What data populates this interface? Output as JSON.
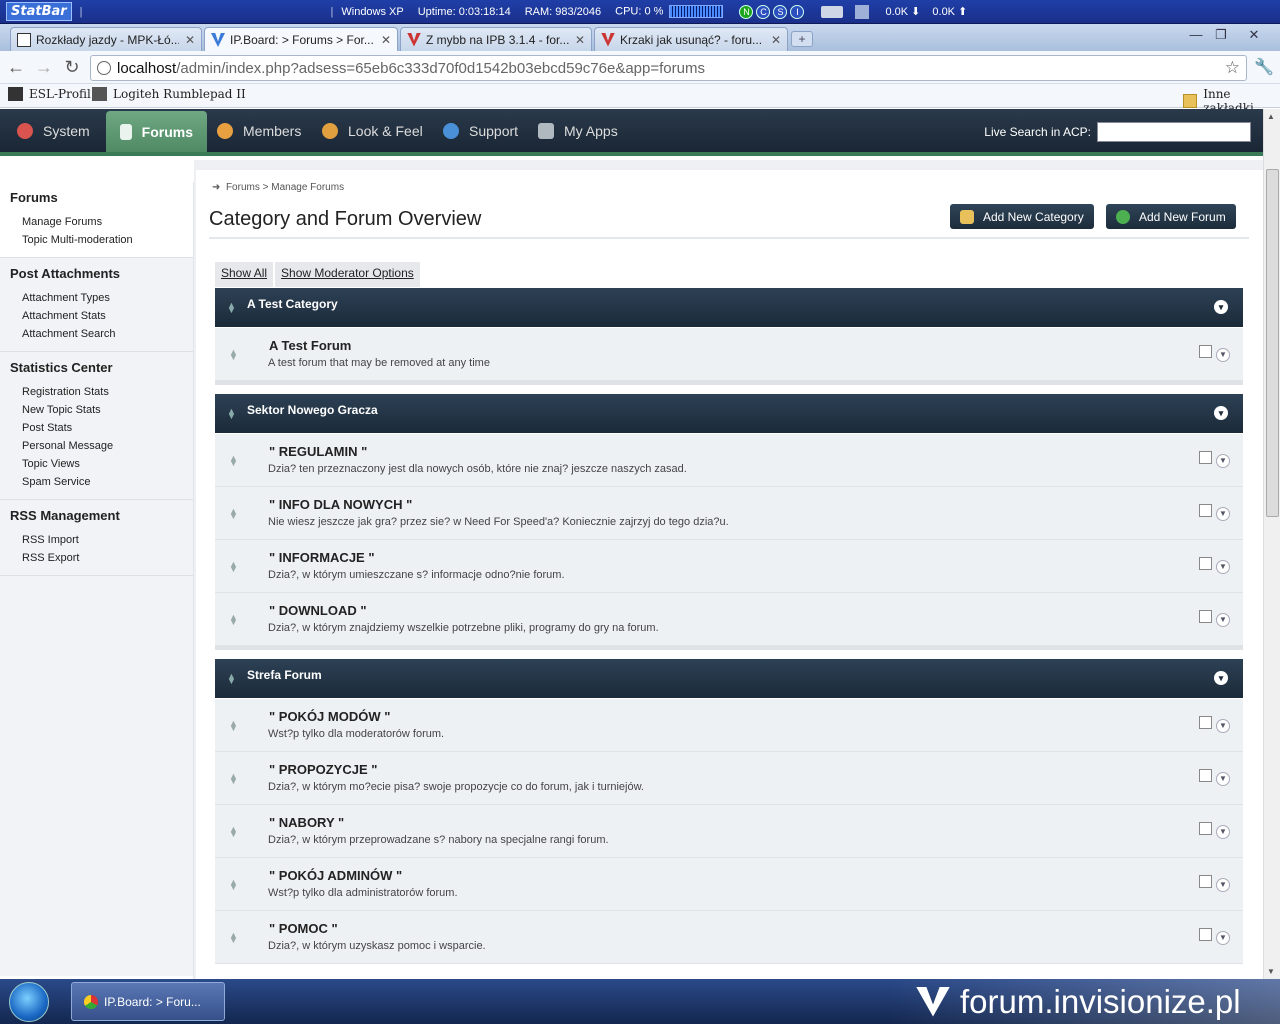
{
  "statbar": {
    "logo": "StatBar",
    "os": "Windows XP",
    "uptime_label": "Uptime:",
    "uptime_value": "0:03:18:14",
    "ram_label": "RAM:",
    "ram_value": "983/2046",
    "cpu_label": "CPU:",
    "cpu_value": "0 %",
    "indicators": [
      "N",
      "C",
      "S",
      "I"
    ],
    "net_down": "0.0K",
    "net_up": "0.0K"
  },
  "browser": {
    "tabs": [
      {
        "label": "Rozkłady jazdy - MPK-Łó..."
      },
      {
        "label": "IP.Board: > Forums > For..."
      },
      {
        "label": "Z mybb na IPB 3.1.4 - for..."
      },
      {
        "label": "Krzaki jak usunąć? - foru..."
      }
    ],
    "new_tab": "+",
    "url_host": "localhost",
    "url_path": "/admin/index.php?adsess=65eb6c333d70f0d1542b03ebcd59c76e&app=forums",
    "bookmarks": [
      "ESL-Profil",
      "Logiteh Rumblepad II"
    ],
    "other_bookmarks": "Inne zakładki"
  },
  "acp": {
    "nav": [
      {
        "label": "System",
        "color": "#d9534f"
      },
      {
        "label": "Forums",
        "color": "#ffffff"
      },
      {
        "label": "Members",
        "color": "#e8a040"
      },
      {
        "label": "Look & Feel",
        "color": "#e0a040"
      },
      {
        "label": "Support",
        "color": "#4a90d9"
      },
      {
        "label": "My Apps",
        "color": "#b0b8c0"
      }
    ],
    "live_search_label": "Live Search in ACP:"
  },
  "sidebar": {
    "sections": [
      {
        "title": "Forums",
        "items": [
          "Manage Forums",
          "Topic Multi-moderation"
        ]
      },
      {
        "title": "Post Attachments",
        "items": [
          "Attachment Types",
          "Attachment Stats",
          "Attachment Search"
        ]
      },
      {
        "title": "Statistics Center",
        "items": [
          "Registration Stats",
          "New Topic Stats",
          "Post Stats",
          "Personal Message",
          "Topic Views",
          "Spam Service"
        ]
      },
      {
        "title": "RSS Management",
        "items": [
          "RSS Import",
          "RSS Export"
        ]
      }
    ]
  },
  "main": {
    "breadcrumb": [
      "Forums",
      ">",
      "Manage Forums"
    ],
    "title": "Category and Forum Overview",
    "add_category": "Add New Category",
    "add_forum": "Add New Forum",
    "show_all": "Show All",
    "show_mod": "Show Moderator Options",
    "categories": [
      {
        "name": "A Test Category",
        "forums": [
          {
            "name": "A Test Forum",
            "desc": "A test forum that may be removed at any time"
          }
        ]
      },
      {
        "name": "Sektor Nowego Gracza",
        "forums": [
          {
            "name": "\" REGULAMIN \"",
            "desc": "Dzia? ten przeznaczony jest dla nowych osób, które nie znaj? jeszcze naszych zasad."
          },
          {
            "name": "\" INFO DLA NOWYCH \"",
            "desc": "Nie wiesz jeszcze jak gra? przez sie? w Need For Speed'a? Koniecznie zajrzyj do tego dzia?u."
          },
          {
            "name": "\" INFORMACJE \"",
            "desc": "Dzia?, w którym umieszczane s? informacje odno?nie forum."
          },
          {
            "name": "\" DOWNLOAD \"",
            "desc": "Dzia?, w którym znajdziemy wszelkie potrzebne pliki, programy do gry na forum."
          }
        ]
      },
      {
        "name": "Strefa Forum",
        "forums": [
          {
            "name": "\" POKÓJ MODÓW \"",
            "desc": "Wst?p tylko dla moderatorów forum."
          },
          {
            "name": "\" PROPOZYCJE \"",
            "desc": "Dzia?, w którym mo?ecie pisa? swoje propozycje co do forum, jak i turniejów."
          },
          {
            "name": "\" NABORY \"",
            "desc": "Dzia?, w którym przeprowadzane s? nabory na specjalne rangi forum."
          },
          {
            "name": "\" POKÓJ ADMINÓW \"",
            "desc": "Wst?p tylko dla administratorów forum."
          },
          {
            "name": "\" POMOC \"",
            "desc": "Dzia?, w którym uzyskasz pomoc i wsparcie."
          }
        ]
      }
    ]
  },
  "taskbar": {
    "item": "IP.Board: > Foru...",
    "watermark": "forum.invisionize.pl"
  }
}
